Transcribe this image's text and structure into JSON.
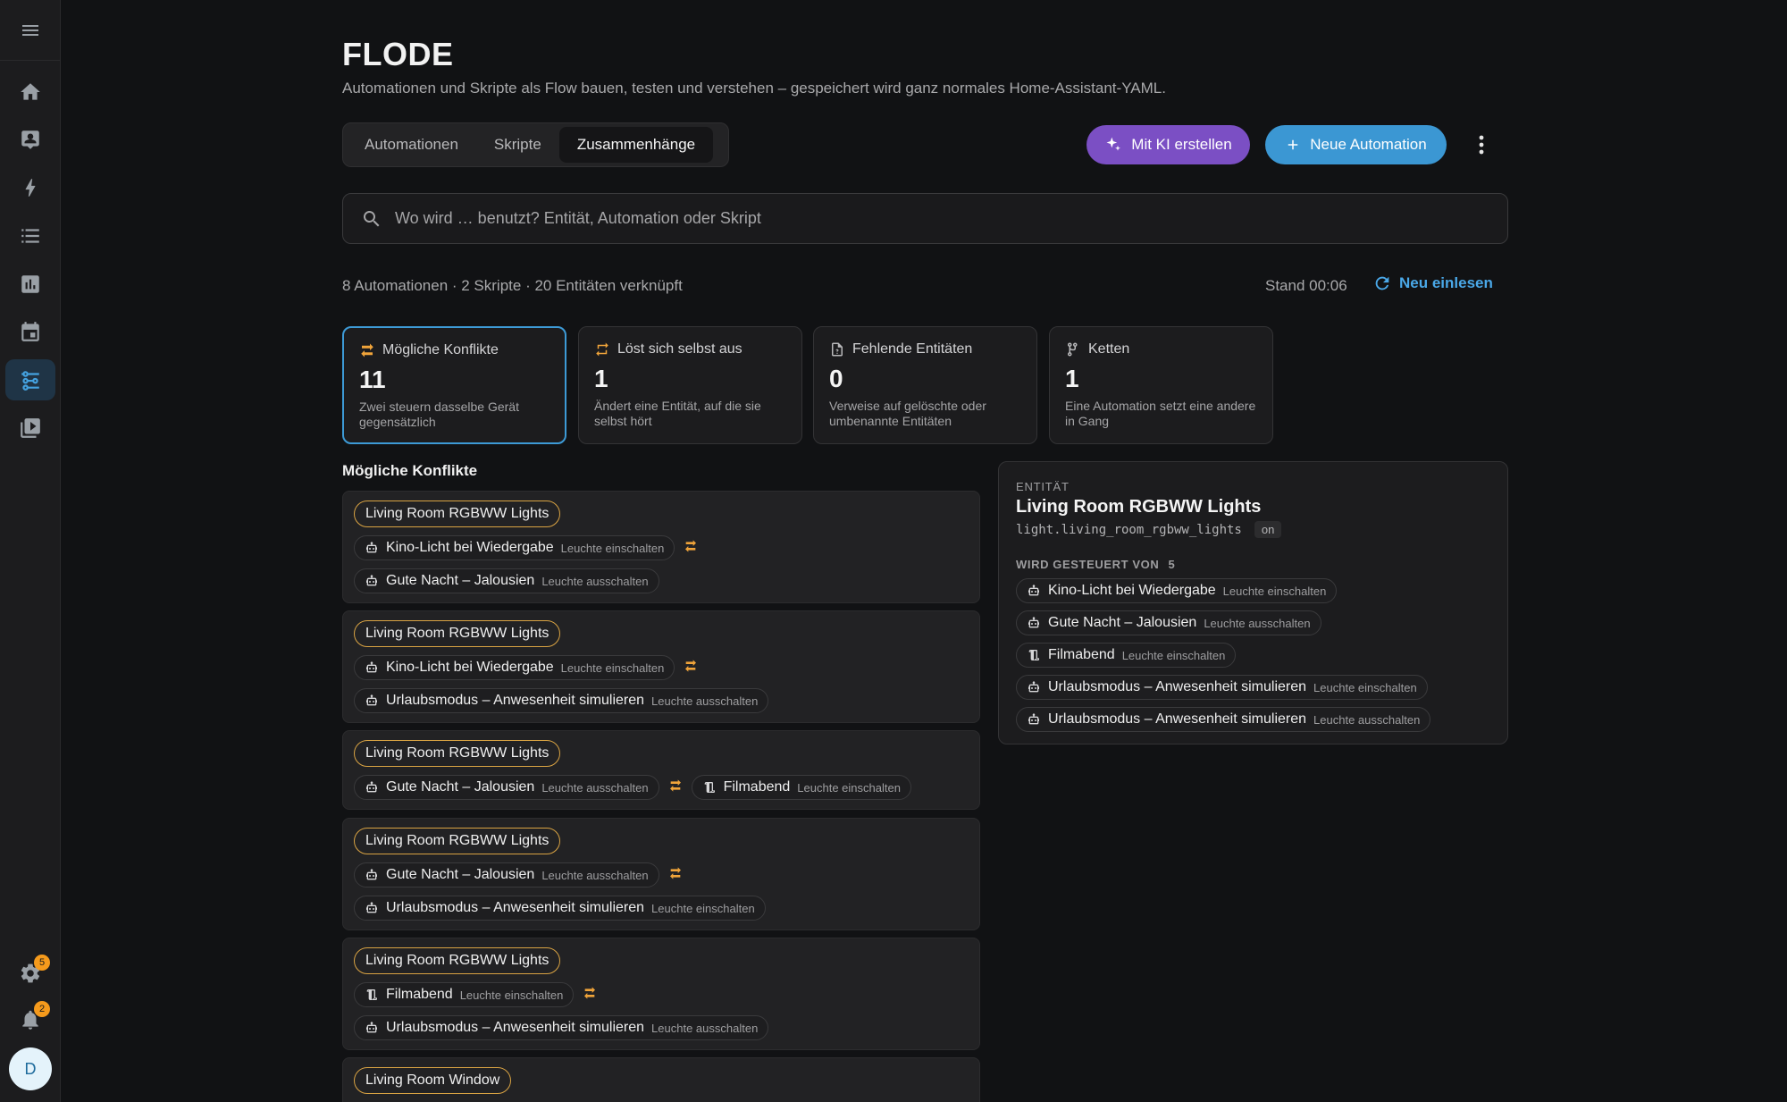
{
  "app": {
    "title": "FLODE",
    "subtitle": "Automationen und Skripte als Flow bauen, testen und verstehen – gespeichert wird ganz normales Home-Assistant-YAML."
  },
  "sidebar": {
    "items": [
      {
        "name": "home",
        "icon": "home-icon"
      },
      {
        "name": "person",
        "icon": "person-card-icon"
      },
      {
        "name": "energy",
        "icon": "lightning-icon"
      },
      {
        "name": "logbook",
        "icon": "list-icon"
      },
      {
        "name": "history",
        "icon": "chart-icon"
      },
      {
        "name": "calendar",
        "icon": "calendar-icon"
      },
      {
        "name": "flode",
        "icon": "flow-icon",
        "active": true
      },
      {
        "name": "media",
        "icon": "media-icon"
      }
    ],
    "settings_badge": "5",
    "notifications_badge": "2",
    "avatar_initial": "D"
  },
  "tabs": [
    {
      "label": "Automationen",
      "active": false
    },
    {
      "label": "Skripte",
      "active": false
    },
    {
      "label": "Zusammenhänge",
      "active": true
    }
  ],
  "toolbar": {
    "ai_label": "Mit KI erstellen",
    "new_label": "Neue Automation"
  },
  "search": {
    "placeholder": "Wo wird … benutzt? Entität, Automation oder Skript"
  },
  "status": {
    "stats": "8 Automationen · 2 Skripte · 20 Entitäten verknüpft",
    "stand": "Stand 00:06",
    "reload_label": "Neu einlesen"
  },
  "cards": [
    {
      "title": "Mögliche Konflikte",
      "value": "11",
      "desc": "Zwei steuern dasselbe Gerät gegensätzlich"
    },
    {
      "title": "Löst sich selbst aus",
      "value": "1",
      "desc": "Ändert eine Entität, auf die sie selbst hört"
    },
    {
      "title": "Fehlende Entitäten",
      "value": "0",
      "desc": "Verweise auf gelöschte oder umbenannte Entitäten"
    },
    {
      "title": "Ketten",
      "value": "1",
      "desc": "Eine Automation setzt eine andere in Gang"
    }
  ],
  "conflicts": {
    "title": "Mögliche Konflikte",
    "groups": [
      {
        "entity": "Living Room RGBWW Lights",
        "a_name": "Kino-Licht bei Wiedergabe",
        "a_action": "Leuchte einschalten",
        "b_name": "Gute Nacht – Jalousien",
        "b_action": "Leuchte ausschalten"
      },
      {
        "entity": "Living Room RGBWW Lights",
        "a_name": "Kino-Licht bei Wiedergabe",
        "a_action": "Leuchte einschalten",
        "b_name": "Urlaubsmodus – Anwesenheit simulieren",
        "b_action": "Leuchte ausschalten"
      },
      {
        "entity": "Living Room RGBWW Lights",
        "a_name": "Gute Nacht – Jalousien",
        "a_action": "Leuchte ausschalten",
        "b_name": "Filmabend",
        "b_action": "Leuchte einschalten"
      },
      {
        "entity": "Living Room RGBWW Lights",
        "a_name": "Gute Nacht – Jalousien",
        "a_action": "Leuchte ausschalten",
        "b_name": "Urlaubsmodus – Anwesenheit simulieren",
        "b_action": "Leuchte einschalten"
      },
      {
        "entity": "Living Room RGBWW Lights",
        "a_name": "Filmabend",
        "a_action": "Leuchte einschalten",
        "b_name": "Urlaubsmodus – Anwesenheit simulieren",
        "b_action": "Leuchte ausschalten"
      },
      {
        "entity": "Living Room Window"
      }
    ]
  },
  "panel": {
    "kicker": "ENTITÄT",
    "title": "Living Room RGBWW Lights",
    "entity_id": "light.living_room_rgbww_lights",
    "state": "on",
    "controlled_label": "WIRD GESTEUERT VON",
    "controlled_count": "5",
    "controllers": [
      {
        "name": "Kino-Licht bei Wiedergabe",
        "action": "Leuchte einschalten",
        "kind": "automation"
      },
      {
        "name": "Gute Nacht – Jalousien",
        "action": "Leuchte ausschalten",
        "kind": "automation"
      },
      {
        "name": "Filmabend",
        "action": "Leuchte einschalten",
        "kind": "script"
      },
      {
        "name": "Urlaubsmodus – Anwesenheit simulieren",
        "action": "Leuchte einschalten",
        "kind": "automation"
      },
      {
        "name": "Urlaubsmodus – Anwesenheit simulieren",
        "action": "Leuchte ausschalten",
        "kind": "automation"
      }
    ]
  },
  "colors": {
    "accent_blue": "#3b97d3",
    "ai_purple": "#7b4fc4",
    "warning_orange": "#f59a1c",
    "entity_chip_border": "#d9a343"
  }
}
